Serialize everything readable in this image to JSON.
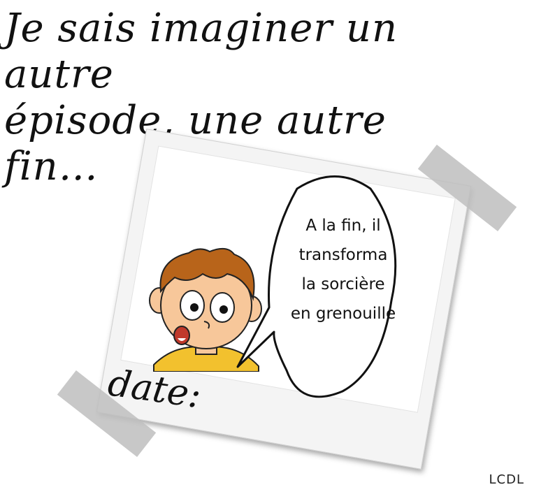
{
  "title": {
    "line1": "Je sais imaginer un autre",
    "line2": "épisode, une autre fin…"
  },
  "speech_bubble": {
    "line1": "A la fin, il",
    "line2": "transforma",
    "line3": "la sorcière",
    "line4": "en grenouille"
  },
  "polaroid": {
    "date_label": "date:"
  },
  "credit": "LCDL",
  "colors": {
    "hair": "#b8641a",
    "skin": "#f7c79a",
    "shirt": "#f2c12e",
    "tape": "#bebebe"
  }
}
